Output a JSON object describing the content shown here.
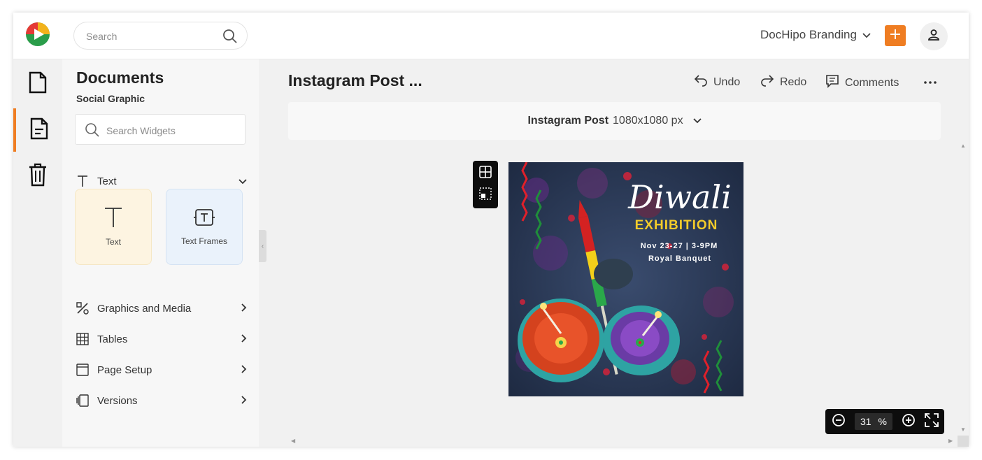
{
  "header": {
    "search_placeholder": "Search",
    "brand_label": "DocHipo Branding",
    "colors": {
      "accent": "#ef7d22"
    }
  },
  "rail": {
    "items": [
      {
        "icon": "document-icon"
      },
      {
        "icon": "document-lines-icon",
        "active": true
      },
      {
        "icon": "trash-icon"
      }
    ]
  },
  "panel": {
    "title": "Documents",
    "subtitle": "Social Graphic",
    "search_placeholder": "Search Widgets",
    "text_section": "Text",
    "cards": [
      {
        "label": "Text",
        "icon": "text-t-icon"
      },
      {
        "label": "Text Frames",
        "icon": "text-frame-icon"
      }
    ],
    "sections": [
      {
        "label": "Graphics and Media",
        "icon": "graphics-icon"
      },
      {
        "label": "Tables",
        "icon": "table-icon"
      },
      {
        "label": "Page Setup",
        "icon": "page-setup-icon"
      },
      {
        "label": "Versions",
        "icon": "versions-icon"
      }
    ]
  },
  "main": {
    "doc_title": "Instagram Post ...",
    "undo": "Undo",
    "redo": "Redo",
    "comments": "Comments",
    "size_name": "Instagram Post",
    "size_dims": "1080x1080 px"
  },
  "poster": {
    "title": "Diwali",
    "subtitle": "EXHIBITION",
    "date_line": "Nov 23-27 | 3-9PM",
    "venue": "Royal Banquet"
  },
  "zoom": {
    "value": "31",
    "unit": "%"
  }
}
